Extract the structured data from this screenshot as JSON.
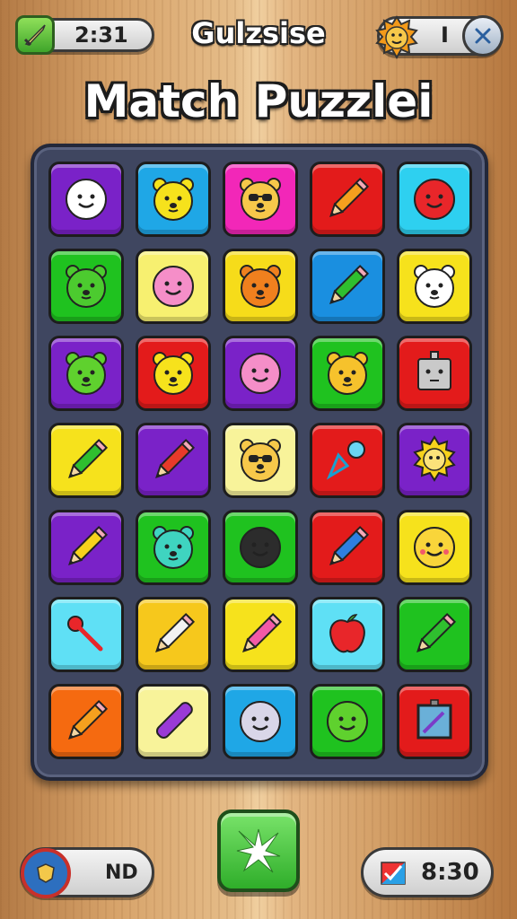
{
  "header": {
    "timer": "2:31",
    "title": "Gulzsise",
    "counter": "I",
    "subtitle": "Match Puzzlei"
  },
  "footer": {
    "left_label": "ND",
    "right_time": "8:30"
  },
  "board": {
    "rows": 7,
    "cols": 5,
    "tiles": [
      [
        {
          "color": "#7a22c8",
          "icon": "white-smiley-face"
        },
        {
          "color": "#1fa7e6",
          "icon": "bear-face"
        },
        {
          "color": "#f227b8",
          "icon": "bear-with-sunglasses"
        },
        {
          "color": "#e31b1b",
          "icon": "orange-pencil"
        },
        {
          "color": "#2ed0f0",
          "icon": "red-face"
        }
      ],
      [
        {
          "color": "#1fc21f",
          "icon": "green-bear-face"
        },
        {
          "color": "#f7f070",
          "icon": "pink-face"
        },
        {
          "color": "#f6dc1a",
          "icon": "orange-bear-face"
        },
        {
          "color": "#1a8fe0",
          "icon": "green-pencil"
        },
        {
          "color": "#f6e21c",
          "icon": "white-owl-face"
        }
      ],
      [
        {
          "color": "#7a22c8",
          "icon": "green-cat-face"
        },
        {
          "color": "#e31b1b",
          "icon": "yellow-bear-face"
        },
        {
          "color": "#7a22c8",
          "icon": "pink-face"
        },
        {
          "color": "#1fc21f",
          "icon": "yellow-fox-face"
        },
        {
          "color": "#e31b1b",
          "icon": "robot-face"
        }
      ],
      [
        {
          "color": "#f6e21c",
          "icon": "green-pencil"
        },
        {
          "color": "#7a22c8",
          "icon": "red-pencil"
        },
        {
          "color": "#f8f39a",
          "icon": "bear-with-sunglasses"
        },
        {
          "color": "#e31b1b",
          "icon": "triangle-orb"
        },
        {
          "color": "#7a22c8",
          "icon": "lion-face"
        }
      ],
      [
        {
          "color": "#7a22c8",
          "icon": "yellow-pencil"
        },
        {
          "color": "#1fc21f",
          "icon": "teal-bear-face"
        },
        {
          "color": "#1fc21f",
          "icon": "dark-blob-face"
        },
        {
          "color": "#e31b1b",
          "icon": "blue-pencil"
        },
        {
          "color": "#f6e21c",
          "icon": "yellow-chick-face"
        }
      ],
      [
        {
          "color": "#5fe0f5",
          "icon": "red-key"
        },
        {
          "color": "#f6c81c",
          "icon": "white-pencil"
        },
        {
          "color": "#f6e21c",
          "icon": "pink-pencil"
        },
        {
          "color": "#5fe0f5",
          "icon": "red-apple"
        },
        {
          "color": "#1fc21f",
          "icon": "green-pencil"
        }
      ],
      [
        {
          "color": "#f56a10",
          "icon": "orange-pencil"
        },
        {
          "color": "#f8f39a",
          "icon": "purple-crayon"
        },
        {
          "color": "#1fa7e6",
          "icon": "grey-face"
        },
        {
          "color": "#1fc21f",
          "icon": "green-blob-face"
        },
        {
          "color": "#e31b1b",
          "icon": "picture-frame"
        }
      ]
    ]
  },
  "icons": {
    "timer": "sword-icon",
    "counter_badge": "lion-icon",
    "close": "close-icon",
    "bottom_left": "shield-icon",
    "center": "sparkle-icon",
    "bottom_right": "map-icon"
  }
}
